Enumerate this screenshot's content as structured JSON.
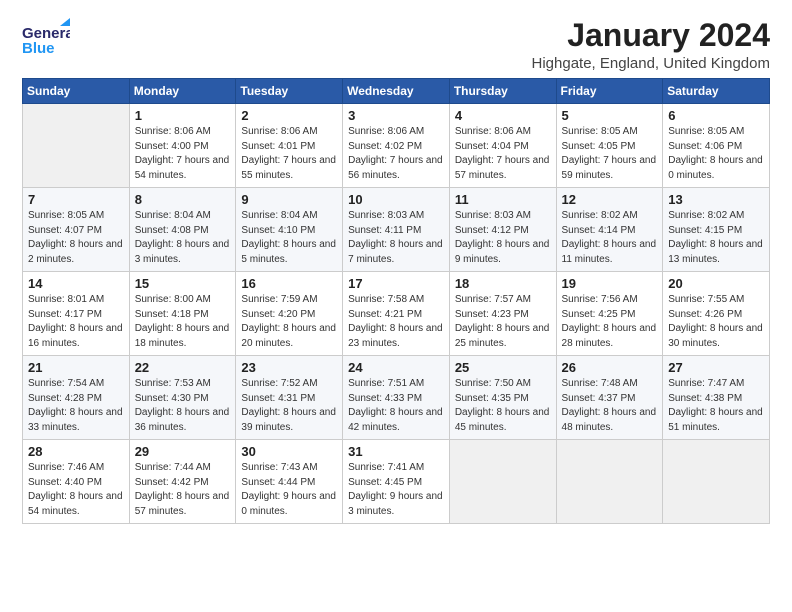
{
  "logo": {
    "general": "General",
    "blue": "Blue"
  },
  "title": "January 2024",
  "subtitle": "Highgate, England, United Kingdom",
  "weekdays": [
    "Sunday",
    "Monday",
    "Tuesday",
    "Wednesday",
    "Thursday",
    "Friday",
    "Saturday"
  ],
  "weeks": [
    [
      {
        "day": "",
        "sunrise": "",
        "sunset": "",
        "daylight": "",
        "empty": true
      },
      {
        "day": "1",
        "sunrise": "Sunrise: 8:06 AM",
        "sunset": "Sunset: 4:00 PM",
        "daylight": "Daylight: 7 hours and 54 minutes."
      },
      {
        "day": "2",
        "sunrise": "Sunrise: 8:06 AM",
        "sunset": "Sunset: 4:01 PM",
        "daylight": "Daylight: 7 hours and 55 minutes."
      },
      {
        "day": "3",
        "sunrise": "Sunrise: 8:06 AM",
        "sunset": "Sunset: 4:02 PM",
        "daylight": "Daylight: 7 hours and 56 minutes."
      },
      {
        "day": "4",
        "sunrise": "Sunrise: 8:06 AM",
        "sunset": "Sunset: 4:04 PM",
        "daylight": "Daylight: 7 hours and 57 minutes."
      },
      {
        "day": "5",
        "sunrise": "Sunrise: 8:05 AM",
        "sunset": "Sunset: 4:05 PM",
        "daylight": "Daylight: 7 hours and 59 minutes."
      },
      {
        "day": "6",
        "sunrise": "Sunrise: 8:05 AM",
        "sunset": "Sunset: 4:06 PM",
        "daylight": "Daylight: 8 hours and 0 minutes."
      }
    ],
    [
      {
        "day": "7",
        "sunrise": "Sunrise: 8:05 AM",
        "sunset": "Sunset: 4:07 PM",
        "daylight": "Daylight: 8 hours and 2 minutes."
      },
      {
        "day": "8",
        "sunrise": "Sunrise: 8:04 AM",
        "sunset": "Sunset: 4:08 PM",
        "daylight": "Daylight: 8 hours and 3 minutes."
      },
      {
        "day": "9",
        "sunrise": "Sunrise: 8:04 AM",
        "sunset": "Sunset: 4:10 PM",
        "daylight": "Daylight: 8 hours and 5 minutes."
      },
      {
        "day": "10",
        "sunrise": "Sunrise: 8:03 AM",
        "sunset": "Sunset: 4:11 PM",
        "daylight": "Daylight: 8 hours and 7 minutes."
      },
      {
        "day": "11",
        "sunrise": "Sunrise: 8:03 AM",
        "sunset": "Sunset: 4:12 PM",
        "daylight": "Daylight: 8 hours and 9 minutes."
      },
      {
        "day": "12",
        "sunrise": "Sunrise: 8:02 AM",
        "sunset": "Sunset: 4:14 PM",
        "daylight": "Daylight: 8 hours and 11 minutes."
      },
      {
        "day": "13",
        "sunrise": "Sunrise: 8:02 AM",
        "sunset": "Sunset: 4:15 PM",
        "daylight": "Daylight: 8 hours and 13 minutes."
      }
    ],
    [
      {
        "day": "14",
        "sunrise": "Sunrise: 8:01 AM",
        "sunset": "Sunset: 4:17 PM",
        "daylight": "Daylight: 8 hours and 16 minutes."
      },
      {
        "day": "15",
        "sunrise": "Sunrise: 8:00 AM",
        "sunset": "Sunset: 4:18 PM",
        "daylight": "Daylight: 8 hours and 18 minutes."
      },
      {
        "day": "16",
        "sunrise": "Sunrise: 7:59 AM",
        "sunset": "Sunset: 4:20 PM",
        "daylight": "Daylight: 8 hours and 20 minutes."
      },
      {
        "day": "17",
        "sunrise": "Sunrise: 7:58 AM",
        "sunset": "Sunset: 4:21 PM",
        "daylight": "Daylight: 8 hours and 23 minutes."
      },
      {
        "day": "18",
        "sunrise": "Sunrise: 7:57 AM",
        "sunset": "Sunset: 4:23 PM",
        "daylight": "Daylight: 8 hours and 25 minutes."
      },
      {
        "day": "19",
        "sunrise": "Sunrise: 7:56 AM",
        "sunset": "Sunset: 4:25 PM",
        "daylight": "Daylight: 8 hours and 28 minutes."
      },
      {
        "day": "20",
        "sunrise": "Sunrise: 7:55 AM",
        "sunset": "Sunset: 4:26 PM",
        "daylight": "Daylight: 8 hours and 30 minutes."
      }
    ],
    [
      {
        "day": "21",
        "sunrise": "Sunrise: 7:54 AM",
        "sunset": "Sunset: 4:28 PM",
        "daylight": "Daylight: 8 hours and 33 minutes."
      },
      {
        "day": "22",
        "sunrise": "Sunrise: 7:53 AM",
        "sunset": "Sunset: 4:30 PM",
        "daylight": "Daylight: 8 hours and 36 minutes."
      },
      {
        "day": "23",
        "sunrise": "Sunrise: 7:52 AM",
        "sunset": "Sunset: 4:31 PM",
        "daylight": "Daylight: 8 hours and 39 minutes."
      },
      {
        "day": "24",
        "sunrise": "Sunrise: 7:51 AM",
        "sunset": "Sunset: 4:33 PM",
        "daylight": "Daylight: 8 hours and 42 minutes."
      },
      {
        "day": "25",
        "sunrise": "Sunrise: 7:50 AM",
        "sunset": "Sunset: 4:35 PM",
        "daylight": "Daylight: 8 hours and 45 minutes."
      },
      {
        "day": "26",
        "sunrise": "Sunrise: 7:48 AM",
        "sunset": "Sunset: 4:37 PM",
        "daylight": "Daylight: 8 hours and 48 minutes."
      },
      {
        "day": "27",
        "sunrise": "Sunrise: 7:47 AM",
        "sunset": "Sunset: 4:38 PM",
        "daylight": "Daylight: 8 hours and 51 minutes."
      }
    ],
    [
      {
        "day": "28",
        "sunrise": "Sunrise: 7:46 AM",
        "sunset": "Sunset: 4:40 PM",
        "daylight": "Daylight: 8 hours and 54 minutes."
      },
      {
        "day": "29",
        "sunrise": "Sunrise: 7:44 AM",
        "sunset": "Sunset: 4:42 PM",
        "daylight": "Daylight: 8 hours and 57 minutes."
      },
      {
        "day": "30",
        "sunrise": "Sunrise: 7:43 AM",
        "sunset": "Sunset: 4:44 PM",
        "daylight": "Daylight: 9 hours and 0 minutes."
      },
      {
        "day": "31",
        "sunrise": "Sunrise: 7:41 AM",
        "sunset": "Sunset: 4:45 PM",
        "daylight": "Daylight: 9 hours and 3 minutes."
      },
      {
        "day": "",
        "sunrise": "",
        "sunset": "",
        "daylight": "",
        "empty": true
      },
      {
        "day": "",
        "sunrise": "",
        "sunset": "",
        "daylight": "",
        "empty": true
      },
      {
        "day": "",
        "sunrise": "",
        "sunset": "",
        "daylight": "",
        "empty": true
      }
    ]
  ]
}
